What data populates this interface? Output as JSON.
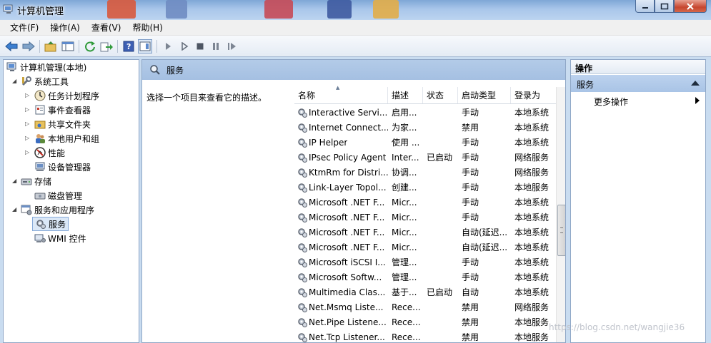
{
  "window": {
    "title": "计算机管理"
  },
  "menu": [
    "文件(F)",
    "操作(A)",
    "查看(V)",
    "帮助(H)"
  ],
  "tree": {
    "root": "计算机管理(本地)",
    "system_tools": "系统工具",
    "task_scheduler": "任务计划程序",
    "event_viewer": "事件查看器",
    "shared_folders": "共享文件夹",
    "local_users": "本地用户和组",
    "performance": "性能",
    "device_manager": "设备管理器",
    "storage": "存储",
    "disk_management": "磁盘管理",
    "services_apps": "服务和应用程序",
    "services": "服务",
    "wmi": "WMI 控件"
  },
  "center": {
    "header": "服务",
    "description": "选择一个项目来查看它的描述。",
    "columns": [
      "名称",
      "描述",
      "状态",
      "启动类型",
      "登录为"
    ],
    "rows": [
      [
        "Interactive Servi...",
        "启用...",
        "",
        "手动",
        "本地系统"
      ],
      [
        "Internet Connect...",
        "为家...",
        "",
        "禁用",
        "本地系统"
      ],
      [
        "IP Helper",
        "使用 ...",
        "",
        "手动",
        "本地系统"
      ],
      [
        "IPsec Policy Agent",
        "Inter...",
        "已启动",
        "手动",
        "网络服务"
      ],
      [
        "KtmRm for Distri...",
        "协调...",
        "",
        "手动",
        "网络服务"
      ],
      [
        "Link-Layer Topol...",
        "创建...",
        "",
        "手动",
        "本地服务"
      ],
      [
        "Microsoft .NET F...",
        "Micr...",
        "",
        "手动",
        "本地系统"
      ],
      [
        "Microsoft .NET F...",
        "Micr...",
        "",
        "手动",
        "本地系统"
      ],
      [
        "Microsoft .NET F...",
        "Micr...",
        "",
        "自动(延迟...",
        "本地系统"
      ],
      [
        "Microsoft .NET F...",
        "Micr...",
        "",
        "自动(延迟...",
        "本地系统"
      ],
      [
        "Microsoft iSCSI I...",
        "管理...",
        "",
        "手动",
        "本地系统"
      ],
      [
        "Microsoft Softw...",
        "管理...",
        "",
        "手动",
        "本地系统"
      ],
      [
        "Multimedia Clas...",
        "基于...",
        "已启动",
        "自动",
        "本地系统"
      ],
      [
        "Net.Msmq Liste...",
        "Rece...",
        "",
        "禁用",
        "网络服务"
      ],
      [
        "Net.Pipe Listene...",
        "Rece...",
        "",
        "禁用",
        "本地服务"
      ],
      [
        "Net.Tcp Listener...",
        "Rece...",
        "",
        "禁用",
        "本地服务"
      ]
    ]
  },
  "actions": {
    "title": "操作",
    "section": "服务",
    "more": "更多操作"
  },
  "watermark": "https://blog.csdn.net/wangjie36"
}
